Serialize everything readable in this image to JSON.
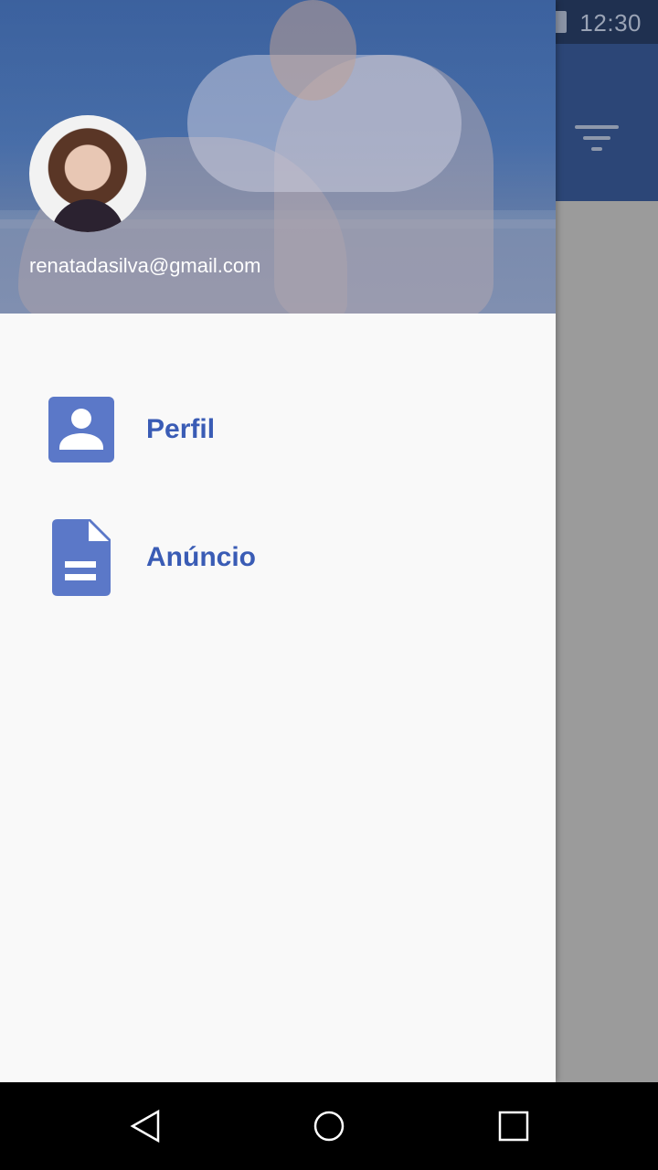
{
  "status_bar": {
    "time": "12:30"
  },
  "toolbar": {
    "filter_icon": "filter-icon"
  },
  "drawer": {
    "header": {
      "email": "renatadasilva@gmail.com"
    },
    "items": [
      {
        "label": "Perfil",
        "icon": "account-box-icon"
      },
      {
        "label": "Anúncio",
        "icon": "document-icon"
      }
    ]
  },
  "colors": {
    "toolbar": "#2c4677",
    "accent": "#3a5cb5",
    "icon": "#5b78c8",
    "scrim": "#9b9b9b"
  },
  "nav_bar": {
    "back": "back-icon",
    "home": "home-icon",
    "recents": "recents-icon"
  }
}
